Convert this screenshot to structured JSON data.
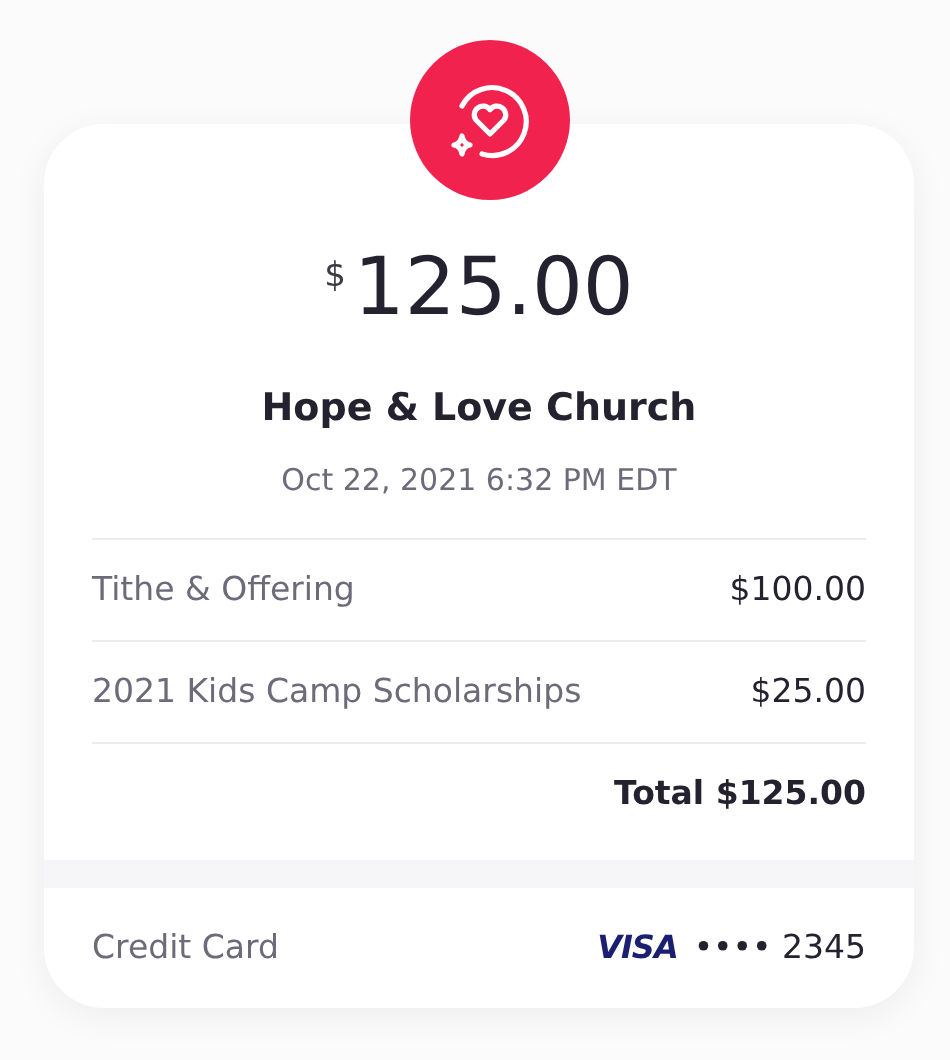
{
  "receipt": {
    "currency_symbol": "$",
    "amount": "125.00",
    "organization": "Hope & Love Church",
    "date": "Oct 22, 2021 6:32 PM EDT"
  },
  "line_items": [
    {
      "label": "Tithe & Offering",
      "amount": "$100.00"
    },
    {
      "label": "2021 Kids Camp Scholarships",
      "amount": "$25.00"
    }
  ],
  "total": "Total $125.00",
  "payment": {
    "method": "Credit Card",
    "brand": "VISA",
    "masked": "•••• 2345"
  }
}
